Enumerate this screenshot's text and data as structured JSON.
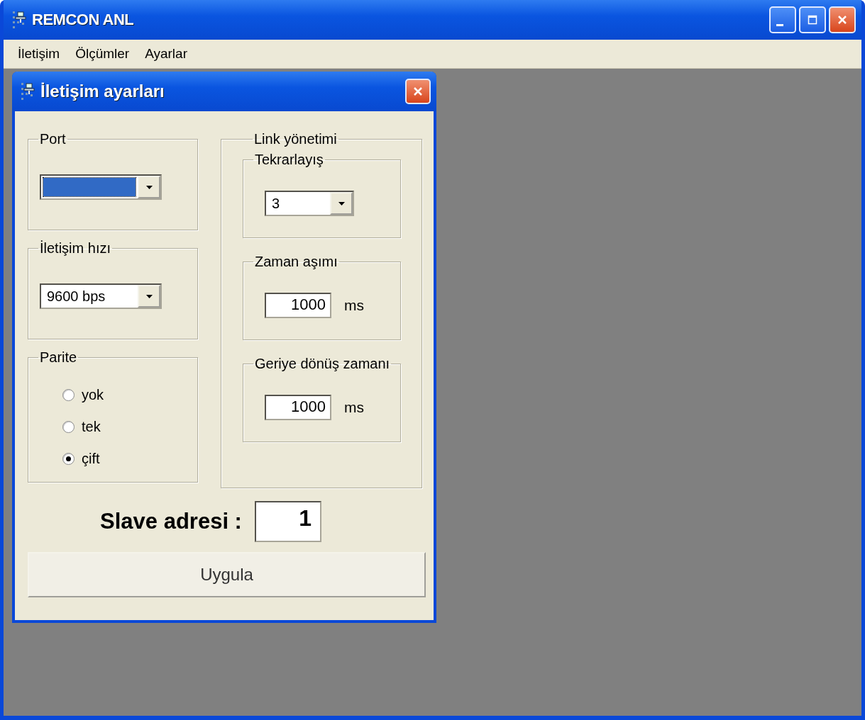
{
  "window": {
    "title": "REMCON ANL"
  },
  "menu": [
    {
      "label": "İletişim"
    },
    {
      "label": "Ölçümler"
    },
    {
      "label": "Ayarlar"
    }
  ],
  "dialog": {
    "title": "İletişim ayarları",
    "port": {
      "legend": "Port",
      "focused": true
    },
    "speed": {
      "legend": "İletişim hızı",
      "value": "9600 bps"
    },
    "parity": {
      "legend": "Parite",
      "options": [
        {
          "label": "yok",
          "selected": false
        },
        {
          "label": "tek",
          "selected": false
        },
        {
          "label": "çift",
          "selected": true
        }
      ]
    },
    "link": {
      "legend": "Link yönetimi",
      "groups": [
        {
          "kind": "dropdown",
          "legend": "Tekrarlayış",
          "value": "3"
        },
        {
          "kind": "number",
          "legend": "Zaman aşımı",
          "value": "1000",
          "unit": "ms"
        },
        {
          "kind": "number",
          "legend": "Geriye dönüş zamanı",
          "value": "1000",
          "unit": "ms"
        }
      ]
    },
    "slave": {
      "label": "Slave adresi :",
      "value": "1"
    },
    "apply_button": "Uygula"
  }
}
